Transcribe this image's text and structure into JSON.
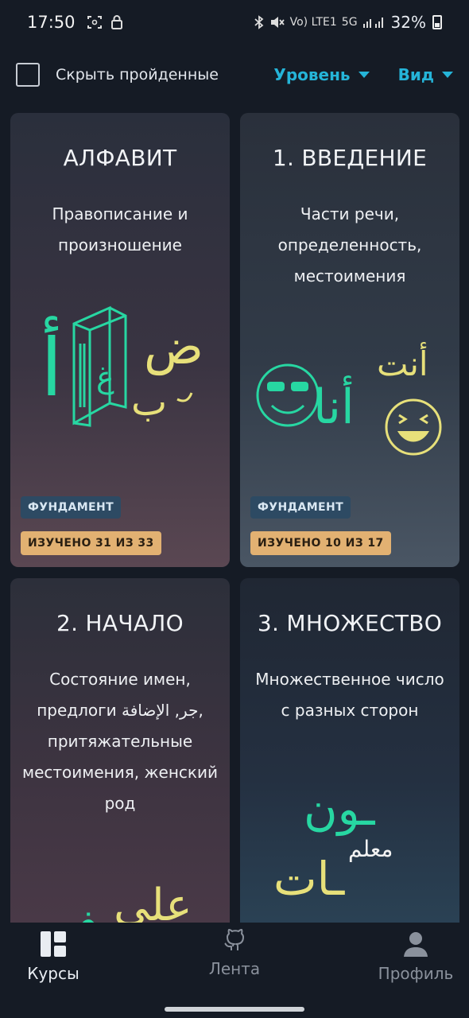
{
  "status_bar": {
    "time": "17:50",
    "battery": "32%",
    "network_label": "Vo) LTE1",
    "network_5g": "5G"
  },
  "filters": {
    "hide_completed_label": "Скрыть пройденные",
    "hide_completed_checked": false,
    "level_label": "Уровень",
    "view_label": "Вид"
  },
  "courses": [
    {
      "title": "АЛФАВИТ",
      "description": "Правописание и произношение",
      "level_badge": "ФУНДАМЕНТ",
      "progress_badge": "ИЗУЧЕНО 31 ИЗ 33",
      "art_glyphs": [
        "أ",
        "غ",
        "ض",
        "ب"
      ]
    },
    {
      "title": "1. ВВЕДЕНИЕ",
      "description": "Части речи, определенность, местоимения",
      "level_badge": "ФУНДАМЕНТ",
      "progress_badge": "ИЗУЧЕНО 10 ИЗ 17",
      "art_glyphs": [
        "أنت",
        "أنا"
      ]
    },
    {
      "title": "2. НАЧАЛО",
      "description": "Состояние имен, предлоги جر, الإضافة, притяжательные местоимения, женский род",
      "art_glyphs": [
        "على",
        "في"
      ]
    },
    {
      "title": "3. МНОЖЕСТВО",
      "description": "Множественное число с разных сторон",
      "art_glyphs": [
        "ـون",
        "معلم",
        "ـات"
      ]
    }
  ],
  "bottom_nav": {
    "items": [
      {
        "label": "Курсы",
        "icon": "grid-icon",
        "active": true
      },
      {
        "label": "Лента",
        "icon": "github-icon",
        "active": false
      },
      {
        "label": "Профиль",
        "icon": "user-icon",
        "active": false
      }
    ]
  },
  "colors": {
    "accent": "#25b4d8",
    "background": "#151b25",
    "badge_level": "#2d4a63",
    "badge_progress": "#e2b172",
    "art_green": "#27d7a2",
    "art_yellow": "#e7e07a"
  }
}
